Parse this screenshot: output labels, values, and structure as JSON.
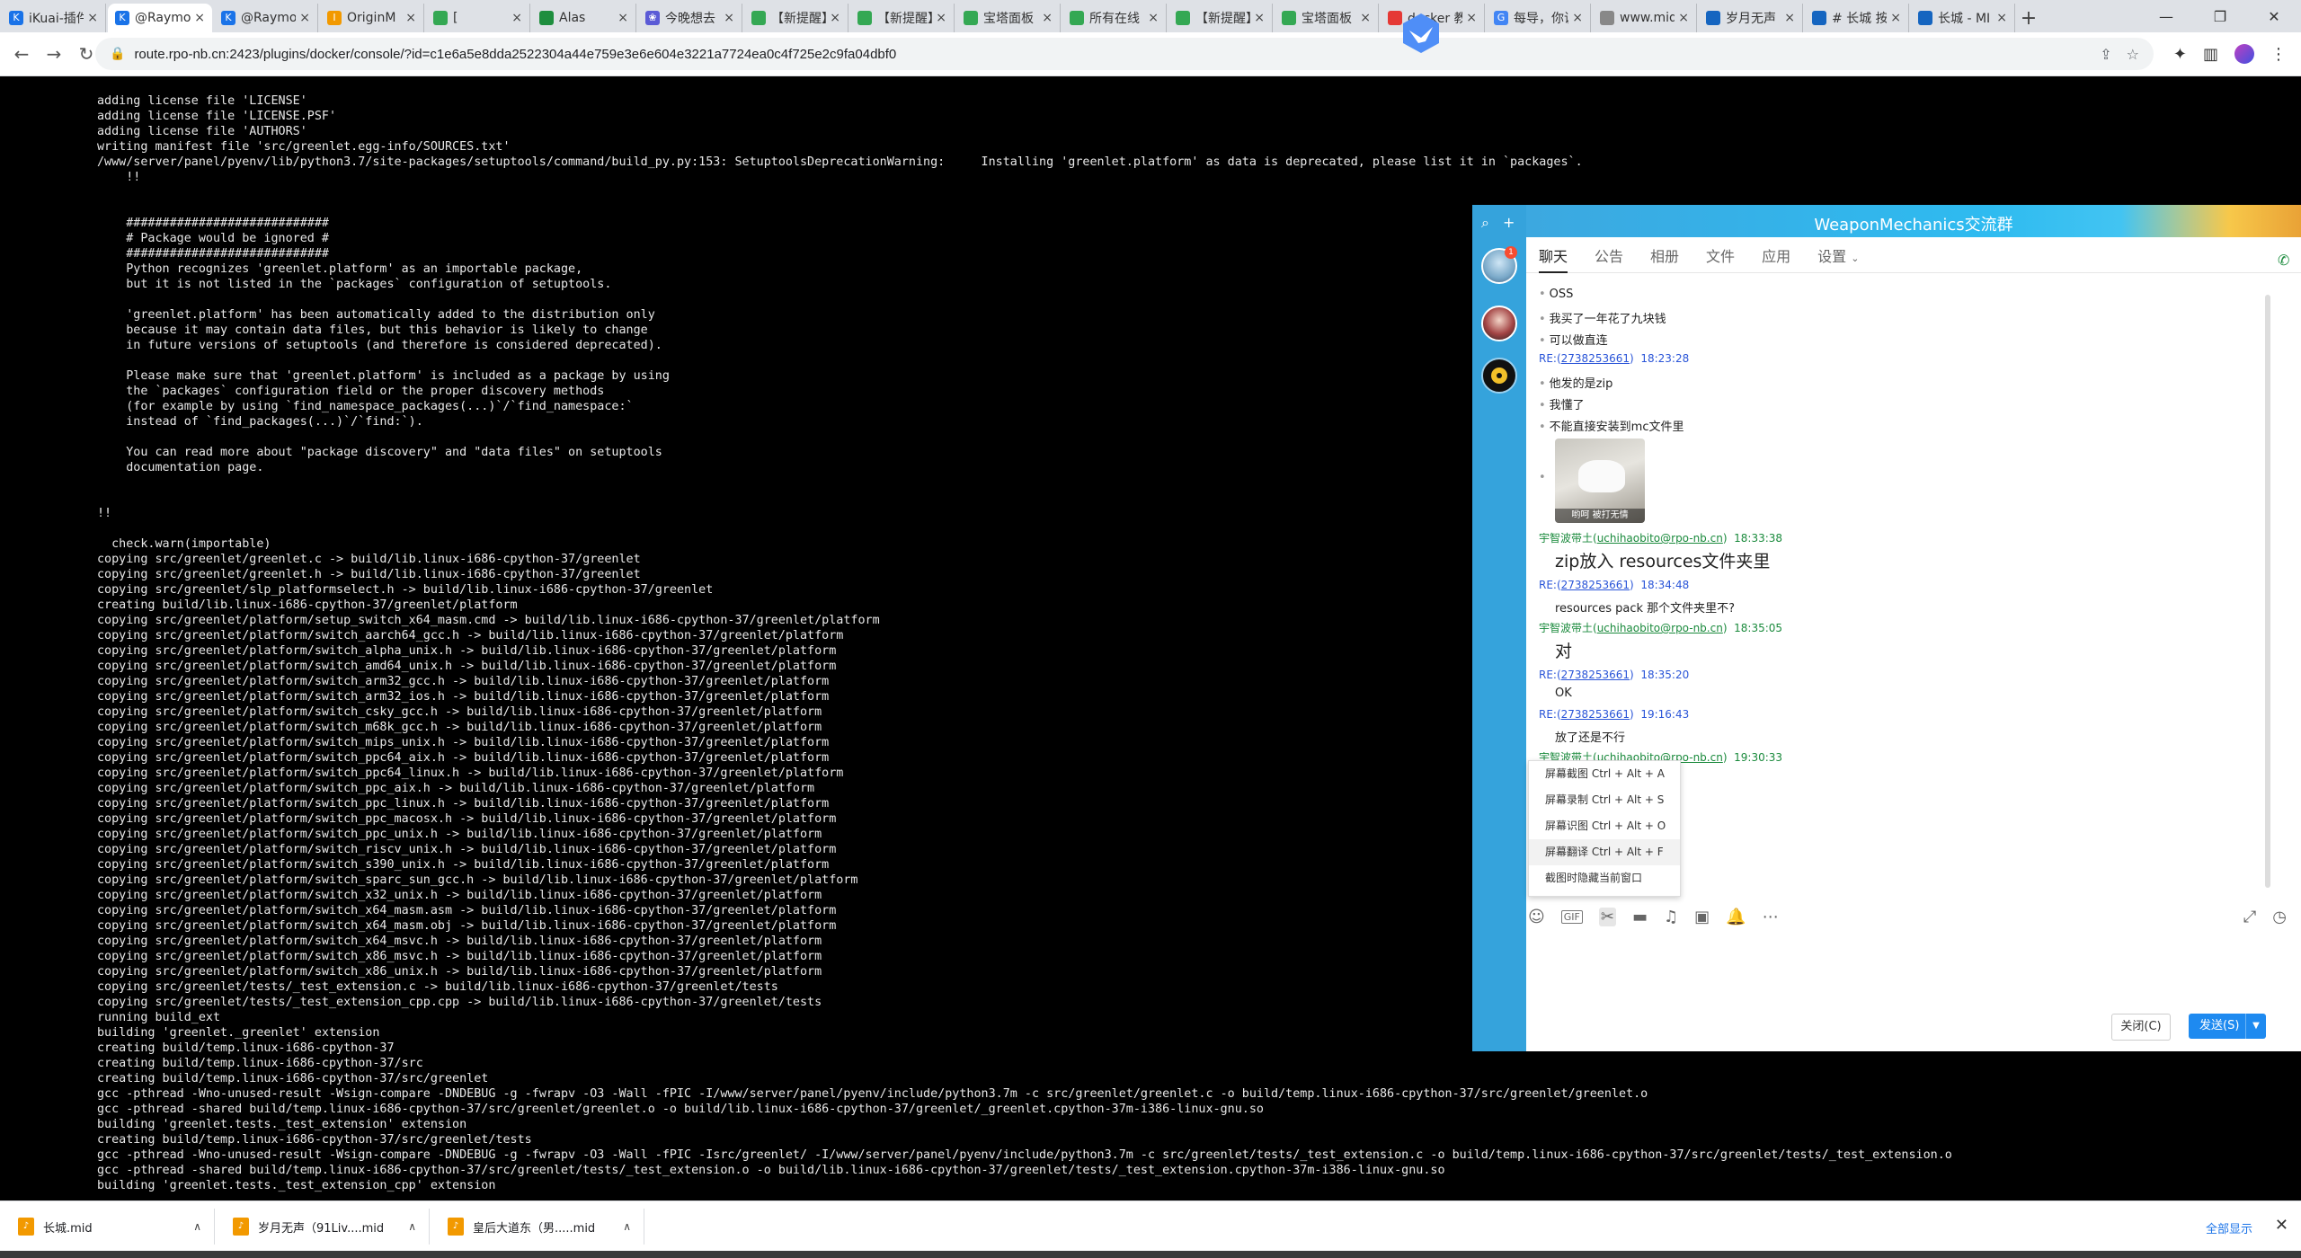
{
  "browser": {
    "tabs": [
      {
        "label": "iKuai-插件",
        "color": "#1a73e8",
        "glyph": "K"
      },
      {
        "label": "@Raymo",
        "color": "#1a73e8",
        "glyph": "K",
        "active": true
      },
      {
        "label": "@Raymo",
        "color": "#1a73e8",
        "glyph": "K"
      },
      {
        "label": "OriginM",
        "color": "#f29900",
        "glyph": "I"
      },
      {
        "label": "[",
        "color": "#34a853",
        "glyph": ""
      },
      {
        "label": "Alas",
        "color": "#1e8e3e",
        "glyph": ""
      },
      {
        "label": "今晚想去",
        "color": "#5b5bd6",
        "glyph": "❀"
      },
      {
        "label": "【新提醒】",
        "color": "#34a853",
        "glyph": ""
      },
      {
        "label": "【新提醒】",
        "color": "#34a853",
        "glyph": ""
      },
      {
        "label": "宝塔面板",
        "color": "#34a853",
        "glyph": ""
      },
      {
        "label": "所有在线",
        "color": "#34a853",
        "glyph": ""
      },
      {
        "label": "【新提醒】",
        "color": "#34a853",
        "glyph": ""
      },
      {
        "label": "宝塔面板",
        "color": "#34a853",
        "glyph": ""
      },
      {
        "label": "docker 教",
        "color": "#e53935",
        "glyph": ""
      },
      {
        "label": "每导，你说",
        "color": "#4285f4",
        "glyph": "G"
      },
      {
        "label": "www.mid",
        "color": "#888888",
        "glyph": ""
      },
      {
        "label": "岁月无声",
        "color": "#1565c0",
        "glyph": ""
      },
      {
        "label": "# 长城 按",
        "color": "#1565c0",
        "glyph": ""
      },
      {
        "label": "长城 - MI",
        "color": "#1565c0",
        "glyph": ""
      }
    ],
    "url": "route.rpo-nb.cn:2423/plugins/docker/console/?id=c1e6a5e8dda2522304a44e759e3e6e604e3221a7724ea0c4f725e2c9fa04dbf0"
  },
  "terminal": {
    "lines": [
      "adding license file 'LICENSE'",
      "adding license file 'LICENSE.PSF'",
      "adding license file 'AUTHORS'",
      "writing manifest file 'src/greenlet.egg-info/SOURCES.txt'",
      "/www/server/panel/pyenv/lib/python3.7/site-packages/setuptools/command/build_py.py:153: SetuptoolsDeprecationWarning:     Installing 'greenlet.platform' as data is deprecated, please list it in `packages`.",
      "    !!",
      "",
      "",
      "    ############################",
      "    # Package would be ignored #",
      "    ############################",
      "    Python recognizes 'greenlet.platform' as an importable package,",
      "    but it is not listed in the `packages` configuration of setuptools.",
      "",
      "    'greenlet.platform' has been automatically added to the distribution only",
      "    because it may contain data files, but this behavior is likely to change",
      "    in future versions of setuptools (and therefore is considered deprecated).",
      "",
      "    Please make sure that 'greenlet.platform' is included as a package by using",
      "    the `packages` configuration field or the proper discovery methods",
      "    (for example by using `find_namespace_packages(...)`/`find_namespace:`",
      "    instead of `find_packages(...)`/`find:`).",
      "",
      "    You can read more about \"package discovery\" and \"data files\" on setuptools",
      "    documentation page.",
      "",
      "",
      "!!",
      "",
      "  check.warn(importable)",
      "copying src/greenlet/greenlet.c -> build/lib.linux-i686-cpython-37/greenlet",
      "copying src/greenlet/greenlet.h -> build/lib.linux-i686-cpython-37/greenlet",
      "copying src/greenlet/slp_platformselect.h -> build/lib.linux-i686-cpython-37/greenlet",
      "creating build/lib.linux-i686-cpython-37/greenlet/platform",
      "copying src/greenlet/platform/setup_switch_x64_masm.cmd -> build/lib.linux-i686-cpython-37/greenlet/platform",
      "copying src/greenlet/platform/switch_aarch64_gcc.h -> build/lib.linux-i686-cpython-37/greenlet/platform",
      "copying src/greenlet/platform/switch_alpha_unix.h -> build/lib.linux-i686-cpython-37/greenlet/platform",
      "copying src/greenlet/platform/switch_amd64_unix.h -> build/lib.linux-i686-cpython-37/greenlet/platform",
      "copying src/greenlet/platform/switch_arm32_gcc.h -> build/lib.linux-i686-cpython-37/greenlet/platform",
      "copying src/greenlet/platform/switch_arm32_ios.h -> build/lib.linux-i686-cpython-37/greenlet/platform",
      "copying src/greenlet/platform/switch_csky_gcc.h -> build/lib.linux-i686-cpython-37/greenlet/platform",
      "copying src/greenlet/platform/switch_m68k_gcc.h -> build/lib.linux-i686-cpython-37/greenlet/platform",
      "copying src/greenlet/platform/switch_mips_unix.h -> build/lib.linux-i686-cpython-37/greenlet/platform",
      "copying src/greenlet/platform/switch_ppc64_aix.h -> build/lib.linux-i686-cpython-37/greenlet/platform",
      "copying src/greenlet/platform/switch_ppc64_linux.h -> build/lib.linux-i686-cpython-37/greenlet/platform",
      "copying src/greenlet/platform/switch_ppc_aix.h -> build/lib.linux-i686-cpython-37/greenlet/platform",
      "copying src/greenlet/platform/switch_ppc_linux.h -> build/lib.linux-i686-cpython-37/greenlet/platform",
      "copying src/greenlet/platform/switch_ppc_macosx.h -> build/lib.linux-i686-cpython-37/greenlet/platform",
      "copying src/greenlet/platform/switch_ppc_unix.h -> build/lib.linux-i686-cpython-37/greenlet/platform",
      "copying src/greenlet/platform/switch_riscv_unix.h -> build/lib.linux-i686-cpython-37/greenlet/platform",
      "copying src/greenlet/platform/switch_s390_unix.h -> build/lib.linux-i686-cpython-37/greenlet/platform",
      "copying src/greenlet/platform/switch_sparc_sun_gcc.h -> build/lib.linux-i686-cpython-37/greenlet/platform",
      "copying src/greenlet/platform/switch_x32_unix.h -> build/lib.linux-i686-cpython-37/greenlet/platform",
      "copying src/greenlet/platform/switch_x64_masm.asm -> build/lib.linux-i686-cpython-37/greenlet/platform",
      "copying src/greenlet/platform/switch_x64_masm.obj -> build/lib.linux-i686-cpython-37/greenlet/platform",
      "copying src/greenlet/platform/switch_x64_msvc.h -> build/lib.linux-i686-cpython-37/greenlet/platform",
      "copying src/greenlet/platform/switch_x86_msvc.h -> build/lib.linux-i686-cpython-37/greenlet/platform",
      "copying src/greenlet/platform/switch_x86_unix.h -> build/lib.linux-i686-cpython-37/greenlet/platform",
      "copying src/greenlet/tests/_test_extension.c -> build/lib.linux-i686-cpython-37/greenlet/tests",
      "copying src/greenlet/tests/_test_extension_cpp.cpp -> build/lib.linux-i686-cpython-37/greenlet/tests",
      "running build_ext",
      "building 'greenlet._greenlet' extension",
      "creating build/temp.linux-i686-cpython-37",
      "creating build/temp.linux-i686-cpython-37/src",
      "creating build/temp.linux-i686-cpython-37/src/greenlet",
      "gcc -pthread -Wno-unused-result -Wsign-compare -DNDEBUG -g -fwrapv -O3 -Wall -fPIC -I/www/server/panel/pyenv/include/python3.7m -c src/greenlet/greenlet.c -o build/temp.linux-i686-cpython-37/src/greenlet/greenlet.o",
      "gcc -pthread -shared build/temp.linux-i686-cpython-37/src/greenlet/greenlet.o -o build/lib.linux-i686-cpython-37/greenlet/_greenlet.cpython-37m-i386-linux-gnu.so",
      "building 'greenlet.tests._test_extension' extension",
      "creating build/temp.linux-i686-cpython-37/src/greenlet/tests",
      "gcc -pthread -Wno-unused-result -Wsign-compare -DNDEBUG -g -fwrapv -O3 -Wall -fPIC -Isrc/greenlet/ -I/www/server/panel/pyenv/include/python3.7m -c src/greenlet/tests/_test_extension.c -o build/temp.linux-i686-cpython-37/src/greenlet/tests/_test_extension.o",
      "gcc -pthread -shared build/temp.linux-i686-cpython-37/src/greenlet/tests/_test_extension.o -o build/lib.linux-i686-cpython-37/greenlet/tests/_test_extension.cpython-37m-i386-linux-gnu.so",
      "building 'greenlet.tests._test_extension_cpp' extension"
    ]
  },
  "qq": {
    "title": "WeaponMechanics交流群",
    "badge": "1",
    "tabs": [
      "聊天",
      "公告",
      "相册",
      "文件",
      "应用",
      "设置"
    ],
    "messages": {
      "m1": "OSS",
      "m2": "我买了一年花了九块钱",
      "m3": "可以做直连",
      "meta1_prefix": "RE:(",
      "meta1_id": "2738253661",
      "meta1_suffix": ")",
      "meta1_time": "18:23:28",
      "m4": "他发的是zip",
      "m5": "我懂了",
      "m6": "不能直接安装到mc文件里",
      "img_caption": "哟呵 被打无情",
      "meta2_name": "宇智波带土(",
      "meta2_email": "uchihaobito@rpo-nb.cn",
      "meta2_suffix": ")",
      "meta2_time": "18:33:38",
      "m7": "zip放入 resources文件夹里",
      "meta3_id": "2738253661",
      "meta3_time": "18:34:48",
      "m8": "resources pack 那个文件夹里不?",
      "meta4_email": "uchihaobito@rpo-nb.cn",
      "meta4_time": "18:35:05",
      "m9": "对",
      "meta5_id": "2738253661",
      "meta5_time": "18:35:20",
      "m10": "OK",
      "meta6_id": "2738253661",
      "meta6_time": "19:16:43",
      "m11": "放了还是不行",
      "meta7_email": "uchihaobito@rpo-nb.cn",
      "meta7_time": "19:30:33"
    },
    "context_menu": [
      "屏幕截图 Ctrl + Alt + A",
      "屏幕录制 Ctrl + Alt + S",
      "屏幕识图 Ctrl + Alt + O",
      "屏幕翻译 Ctrl + Alt + F",
      "截图时隐藏当前窗口"
    ],
    "close_label": "关闭(C)",
    "send_label": "发送(S)"
  },
  "downloads": {
    "items": [
      "长城.mid",
      "岁月无声（91Liv....mid",
      "皇后大道东（男.....mid"
    ],
    "show_all": "全部显示"
  }
}
